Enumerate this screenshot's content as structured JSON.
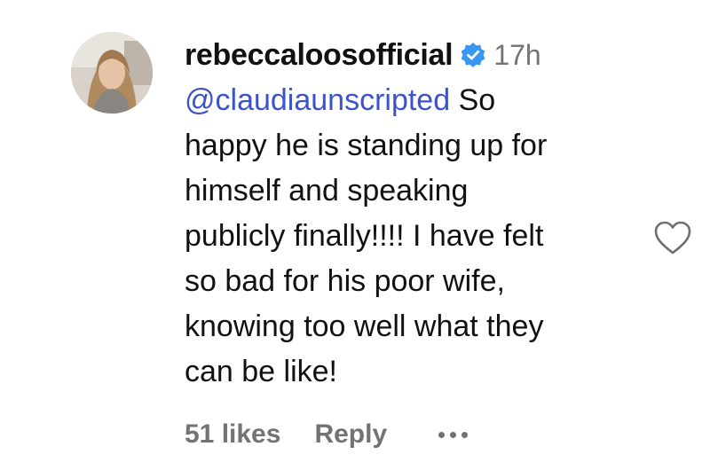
{
  "comment": {
    "username": "rebeccaloosofficial",
    "verified_icon": "verified-badge-icon",
    "time": "17h",
    "mention": "@claudiaunscripted",
    "text_first_line_rest": " So",
    "text_rest": "happy he is standing up for\nhimself and speaking\npublicly finally!!!! I have felt\nso bad for his poor wife,\nknowing too well what they\ncan be like!",
    "likes": "51 likes",
    "reply_label": "Reply",
    "more_icon": "more-options-icon",
    "heart_icon": "heart-outline-icon"
  },
  "colors": {
    "mention": "#3d53c9",
    "verified": "#3897f0",
    "secondary_text": "#737373"
  }
}
